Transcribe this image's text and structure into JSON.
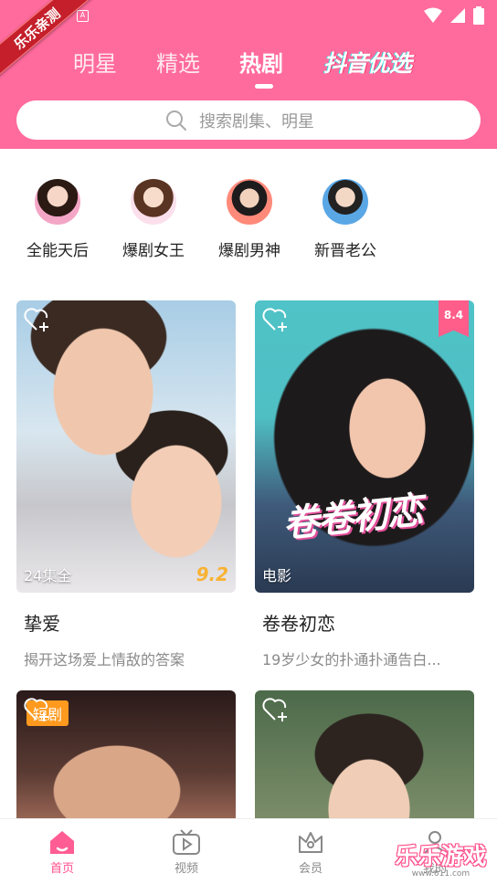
{
  "status_bar": {
    "ribbon_text": "乐乐亲测",
    "mini_badge": "A"
  },
  "tabs": [
    {
      "label": "明星",
      "active": false
    },
    {
      "label": "精选",
      "active": false
    },
    {
      "label": "热剧",
      "active": true
    }
  ],
  "douyin_tab": {
    "label": "抖音优选"
  },
  "search": {
    "placeholder": "搜索剧集、明星"
  },
  "categories": [
    {
      "label": "全能天后",
      "icon": "actress-avatar"
    },
    {
      "label": "爆剧女王",
      "icon": "actress-avatar"
    },
    {
      "label": "爆剧男神",
      "icon": "actor-avatar"
    },
    {
      "label": "新晋老公",
      "icon": "actor-avatar"
    }
  ],
  "cards": [
    {
      "title": "挚爱",
      "desc": "揭开这场爱上情敌的答案",
      "episodes": "24集全",
      "score": "9.2"
    },
    {
      "title": "卷卷初恋",
      "desc": "19岁少女的扑通扑通告白...",
      "episodes": "电影",
      "score": "8.4",
      "poster_text": "卷卷初恋"
    },
    {
      "badge": "短剧"
    },
    {}
  ],
  "bottom_nav": [
    {
      "label": "首页",
      "icon": "home-icon",
      "active": true
    },
    {
      "label": "视频",
      "icon": "tv-icon",
      "active": false
    },
    {
      "label": "会员",
      "icon": "crown-icon",
      "active": false
    },
    {
      "label": "我的",
      "icon": "user-icon",
      "active": false
    }
  ],
  "watermark": {
    "text": "乐乐游戏",
    "url": "www.611.com"
  },
  "colors": {
    "header": "#ff6b9c",
    "accent": "#ff4f8c",
    "score": "#f9b233",
    "badge": "#ff9a1f"
  }
}
